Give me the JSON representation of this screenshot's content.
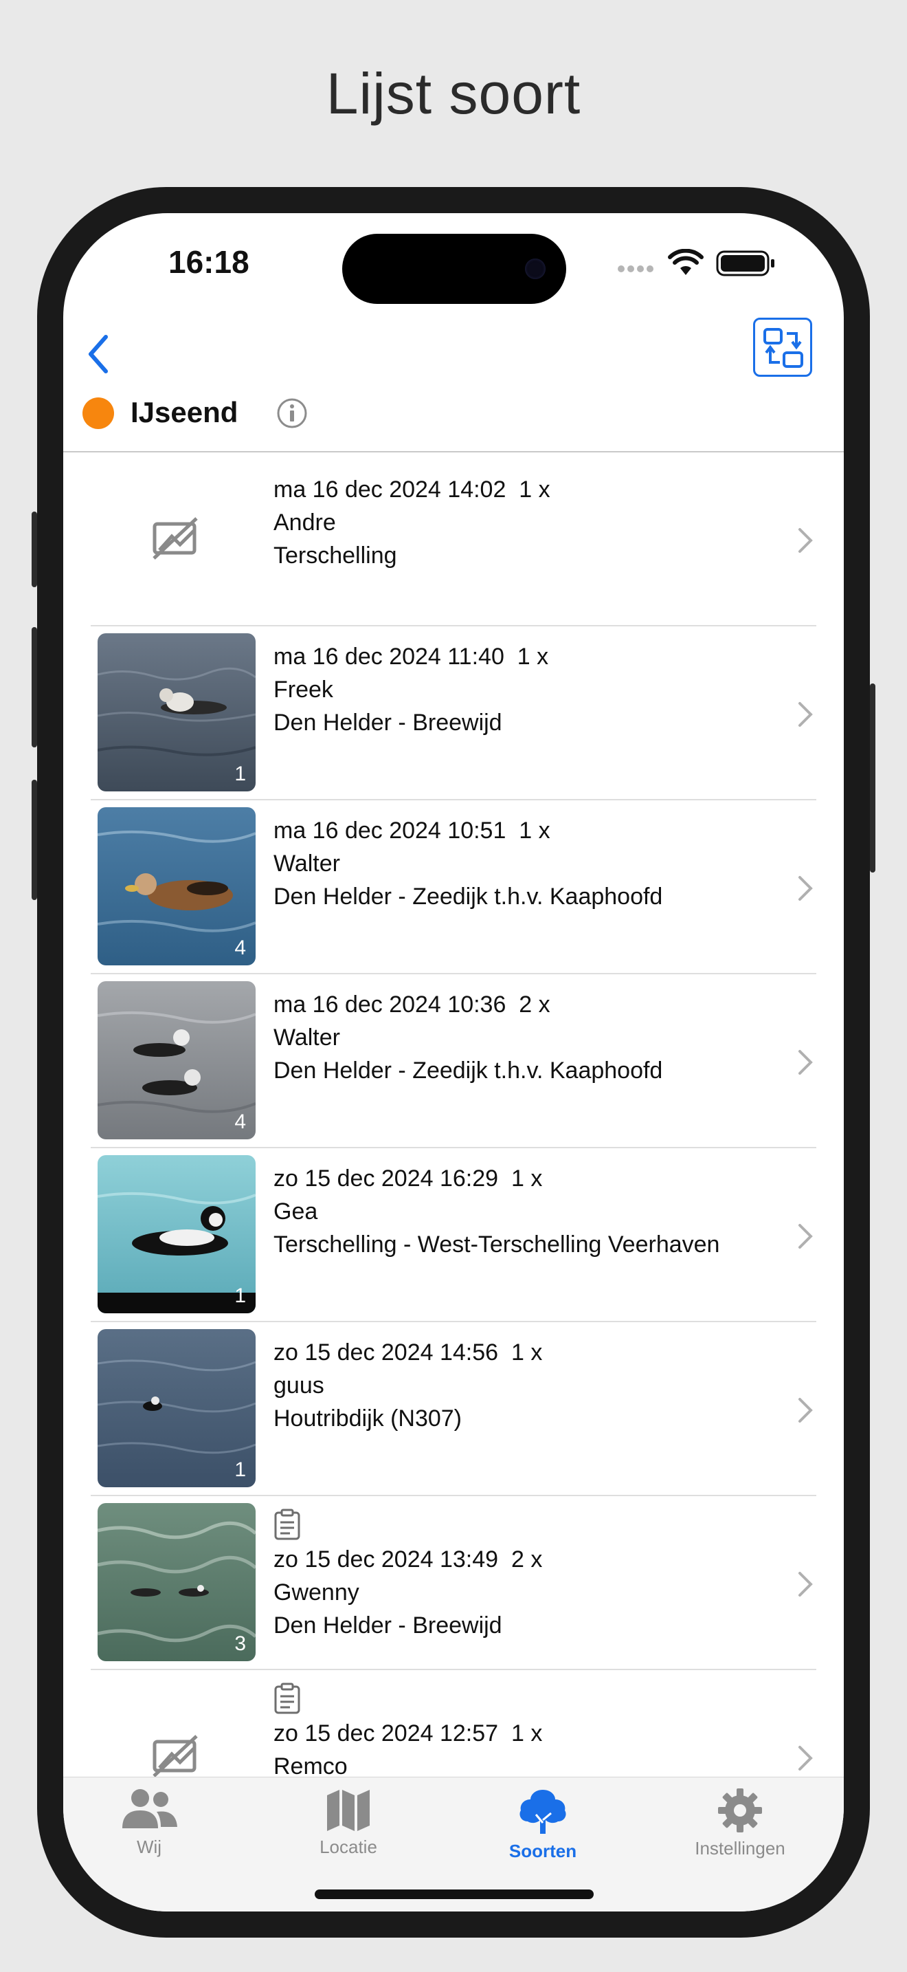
{
  "page_title": "Lijst soort",
  "status": {
    "time": "16:18"
  },
  "species": {
    "name": "IJseend",
    "dot_color": "#f7860e"
  },
  "colors": {
    "accent": "#1a6fe8"
  },
  "observations": [
    {
      "datetime": "ma 16 dec 2024 14:02",
      "count": "1 x",
      "observer": "Andre",
      "location": "Terschelling",
      "photos": "",
      "has_note": false,
      "has_photo": false
    },
    {
      "datetime": "ma 16 dec 2024 11:40",
      "count": "1 x",
      "observer": "Freek",
      "location": "Den Helder - Breewijd",
      "photos": "1",
      "has_note": false,
      "has_photo": true
    },
    {
      "datetime": "ma 16 dec 2024 10:51",
      "count": "1 x",
      "observer": "Walter",
      "location": "Den Helder - Zeedijk t.h.v. Kaaphoofd",
      "photos": "4",
      "has_note": false,
      "has_photo": true
    },
    {
      "datetime": "ma 16 dec 2024 10:36",
      "count": "2 x",
      "observer": "Walter",
      "location": "Den Helder - Zeedijk t.h.v. Kaaphoofd",
      "photos": "4",
      "has_note": false,
      "has_photo": true
    },
    {
      "datetime": "zo 15 dec 2024 16:29",
      "count": "1 x",
      "observer": "Gea",
      "location": "Terschelling - West-Terschelling Veerhaven",
      "photos": "1",
      "has_note": false,
      "has_photo": true
    },
    {
      "datetime": "zo 15 dec 2024 14:56",
      "count": "1 x",
      "observer": "guus",
      "location": "Houtribdijk (N307)",
      "photos": "1",
      "has_note": false,
      "has_photo": true
    },
    {
      "datetime": "zo 15 dec 2024 13:49",
      "count": "2 x",
      "observer": "Gwenny",
      "location": "Den Helder - Breewijd",
      "photos": "3",
      "has_note": true,
      "has_photo": true
    },
    {
      "datetime": "zo 15 dec 2024 12:57",
      "count": "1 x",
      "observer": "Remco",
      "location": "",
      "photos": "",
      "has_note": true,
      "has_photo": false
    }
  ],
  "tabs": [
    {
      "label": "Wij",
      "icon": "people-icon",
      "active": false
    },
    {
      "label": "Locatie",
      "icon": "map-icon",
      "active": false
    },
    {
      "label": "Soorten",
      "icon": "tree-icon",
      "active": true
    },
    {
      "label": "Instellingen",
      "icon": "gear-icon",
      "active": false
    }
  ]
}
